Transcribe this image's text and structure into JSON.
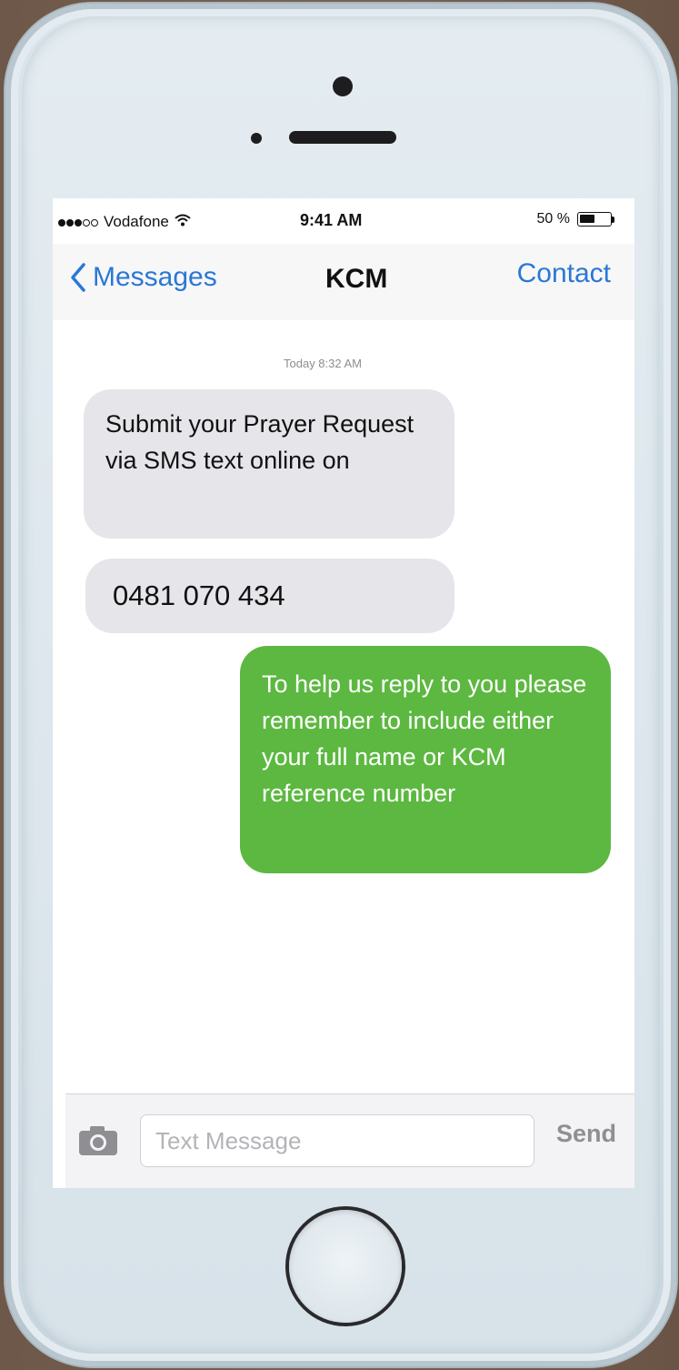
{
  "status_bar": {
    "signal_filled": 3,
    "signal_total": 5,
    "carrier": "Vodafone",
    "time": "9:41 AM",
    "battery_text": "50 %",
    "battery_level": 0.5
  },
  "nav": {
    "back_label": "Messages",
    "title": "KCM",
    "contact_label": "Contact"
  },
  "thread": {
    "timestamp": "Today 8:32 AM",
    "messages": [
      {
        "direction": "incoming",
        "text": "Submit your Prayer Request via SMS text online on"
      },
      {
        "direction": "incoming",
        "text": "0481 070 434"
      },
      {
        "direction": "outgoing",
        "text": "To help us reply to you please remember to include either your full name or KCM reference number"
      }
    ]
  },
  "composer": {
    "placeholder": "Text Message",
    "value": "",
    "send_label": "Send"
  },
  "colors": {
    "accent_blue": "#2a77d6",
    "incoming_bubble": "#e5e5ea",
    "outgoing_bubble": "#5cb840"
  },
  "icons": {
    "back": "chevron-left-icon",
    "wifi": "wifi-icon",
    "battery": "battery-icon",
    "camera": "camera-icon"
  }
}
